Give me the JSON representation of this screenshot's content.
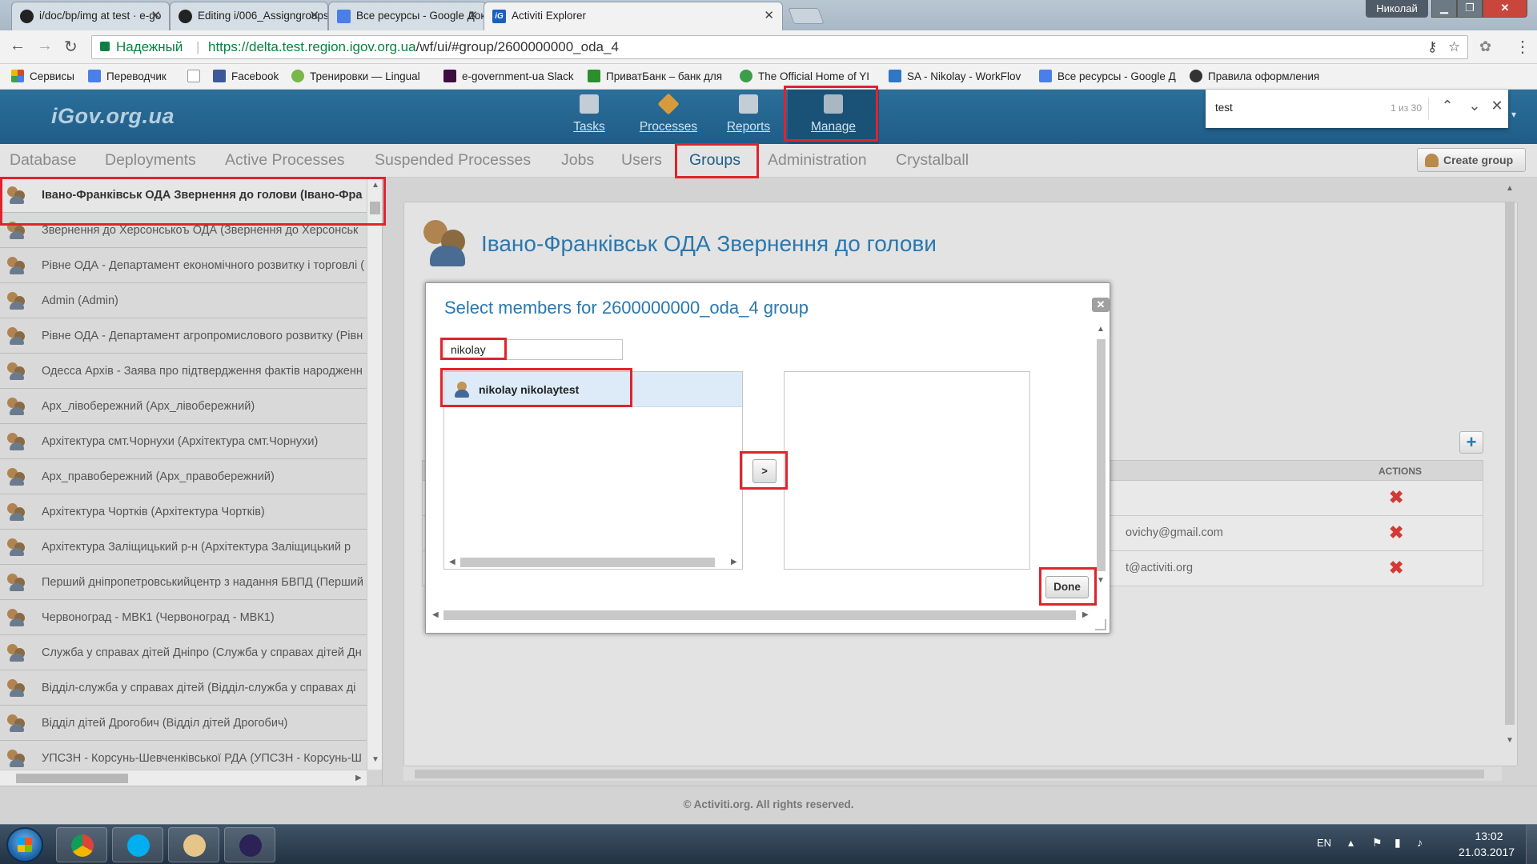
{
  "browser": {
    "tabs": [
      {
        "title": "i/doc/bp/img at test · e-go",
        "icon": "github-icon",
        "active": false
      },
      {
        "title": "Editing i/006_Assigngroups",
        "icon": "github-icon",
        "active": false
      },
      {
        "title": "Все ресурсы - Google Док",
        "icon": "google-docs-icon",
        "active": false
      },
      {
        "title": "Activiti Explorer",
        "icon": "igov-icon",
        "active": true
      }
    ],
    "profile_name": "Николай",
    "security_label": "Надежный",
    "url_base": "https://delta.test.region.igov.org.ua",
    "url_rest": "/wf/ui/#group/2600000000_oda_4",
    "bookmarks": [
      {
        "label": "Сервисы",
        "color": "#d04a2f"
      },
      {
        "label": "Переводчик",
        "color": "#4a7ee8"
      },
      {
        "label": "",
        "color": "#dddddd"
      },
      {
        "label": "Facebook",
        "color": "#3b5998"
      },
      {
        "label": "Тренировки — Lingual",
        "color": "#7ab648"
      },
      {
        "label": "e-government-ua Slack",
        "color": "#3f0e40"
      },
      {
        "label": "ПриватБанк – банк для",
        "color": "#2c8f2c"
      },
      {
        "label": "The Official Home of YI",
        "color": "#3b9e4a"
      },
      {
        "label": "SA - Nikolay - WorkFlov",
        "color": "#2f76c4"
      },
      {
        "label": "Все ресурсы - Google Д",
        "color": "#4a7ee8"
      },
      {
        "label": "Правила оформления",
        "color": "#333333"
      }
    ]
  },
  "find_bar": {
    "query": "test",
    "count": "1 из 30"
  },
  "app": {
    "logo": "iGov.org.ua",
    "main_nav": [
      {
        "label": "Tasks",
        "icon": "tasks-icon"
      },
      {
        "label": "Processes",
        "icon": "processes-icon"
      },
      {
        "label": "Reports",
        "icon": "reports-icon"
      },
      {
        "label": "Manage",
        "icon": "manage-icon"
      }
    ],
    "sub_nav": [
      "Database",
      "Deployments",
      "Active Processes",
      "Suspended Processes",
      "Jobs",
      "Users",
      "Groups",
      "Administration",
      "Crystalball"
    ],
    "create_group_label": "Create group"
  },
  "sidebar": {
    "groups": [
      "Івано-Франківськ ОДА Звернення до голови (Івано-Фра",
      "Звернення до Херсонськоъ ОДА (Звернення до Херсонськ",
      "Рівне ОДА - Департамент економічного розвитку і торговлі (",
      "Admin (Admin)",
      "Рівне ОДА - Департамент агропромислового розвитку (Рівн",
      "Одесса Архів - Заява про підтвердження фактів народженн",
      "Арх_лівобережний (Арх_лівобережний)",
      "Архітектура смт.Чорнухи (Архітектура смт.Чорнухи)",
      "Арх_правобережний (Арх_правобережний)",
      "Архітектура Чортків (Архітектура Чортків)",
      "Архітектура Заліщицький р-н (Архітектура Заліщицький р",
      "Перший дніпропетровськийцентр з надання БВПД (Перший",
      "Червоноград - МВК1 (Червоноград - МВК1)",
      "Служба у справах дітей Дніпро (Служба у справах дітей Дн",
      "Відділ-служба у справах дітей (Відділ-служба у справах ді",
      "Відділ дітей Дрогобич (Відділ дітей Дрогобич)",
      "УПСЗН - Корсунь-Шевченківської РДА (УПСЗН - Корсунь-Ш"
    ]
  },
  "group_detail": {
    "title": "Івано-Франківськ ОДА Звернення до голови",
    "actions_header": "ACTIONS",
    "members": [
      {
        "email": ""
      },
      {
        "email": "ovichy@gmail.com"
      },
      {
        "email": "t@activiti.org"
      }
    ]
  },
  "modal": {
    "title": "Select members for 2600000000_oda_4 group",
    "search_value": "nikolay",
    "candidates": [
      "nikolay nikolaytest"
    ],
    "move_label": ">",
    "done_label": "Done"
  },
  "footer": "© Activiti.org. All rights reserved.",
  "taskbar": {
    "language": "EN",
    "time": "13:02",
    "date": "21.03.2017"
  },
  "colors": {
    "header_blue": "#1f5d87",
    "accent_blue": "#2a78b0",
    "annotation_red": "#e0232c",
    "delete_red": "#d33a36"
  }
}
